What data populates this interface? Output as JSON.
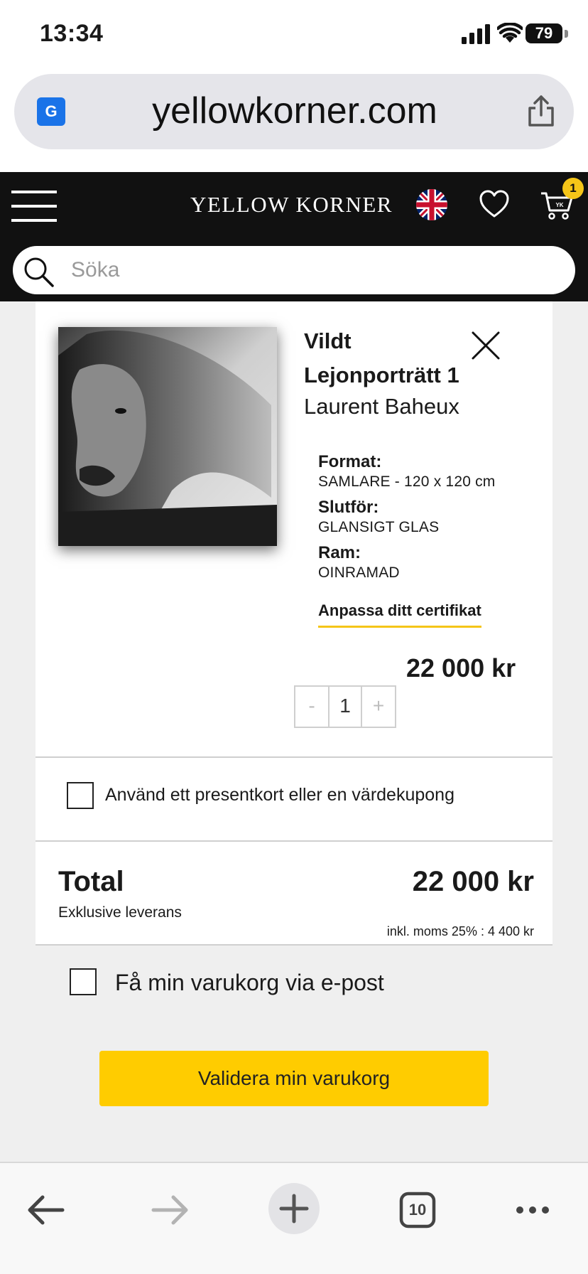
{
  "status_bar": {
    "time": "13:34",
    "battery": "79"
  },
  "browser": {
    "url": "yellowkorner.com"
  },
  "header": {
    "brand": "YELLOW KORNER",
    "cart_count": "1",
    "cart_icon_label": "YK",
    "search_placeholder": "Söka"
  },
  "product": {
    "title": "Vildt Lejonporträtt 1",
    "artist": "Laurent Baheux",
    "specs": [
      {
        "label": "Format:",
        "value": "SAMLARE - 120 x 120 cm"
      },
      {
        "label": "Slutför:",
        "value": "GLANSIGT GLAS"
      },
      {
        "label": "Ram:",
        "value": "OINRAMAD"
      }
    ],
    "certificate_link": "Anpassa ditt certifikat",
    "price": "22 000 kr",
    "quantity": "1",
    "qty_minus": "-",
    "qty_plus": "+"
  },
  "gift_card_label": "Använd ett presentkort eller en värdekupong",
  "summary": {
    "total_label": "Total",
    "total_sub": "Exklusive leverans",
    "total_price": "22 000 kr",
    "vat_text": "inkl. moms 25% : 4 400 kr"
  },
  "email_cart_label": "Få min varukorg via e-post",
  "validate_button": "Validera min varukorg",
  "toolbar": {
    "tabs_count": "10"
  },
  "colors": {
    "accent": "#ffcc00",
    "header_bg": "#111111",
    "page_bg": "#efefef"
  },
  "icons": [
    "translate-icon",
    "share-icon",
    "hamburger-icon",
    "flag-uk-icon",
    "heart-icon",
    "cart-icon",
    "search-icon",
    "close-icon",
    "back-arrow-icon",
    "forward-arrow-icon",
    "plus-icon",
    "tabs-icon",
    "more-icon"
  ]
}
